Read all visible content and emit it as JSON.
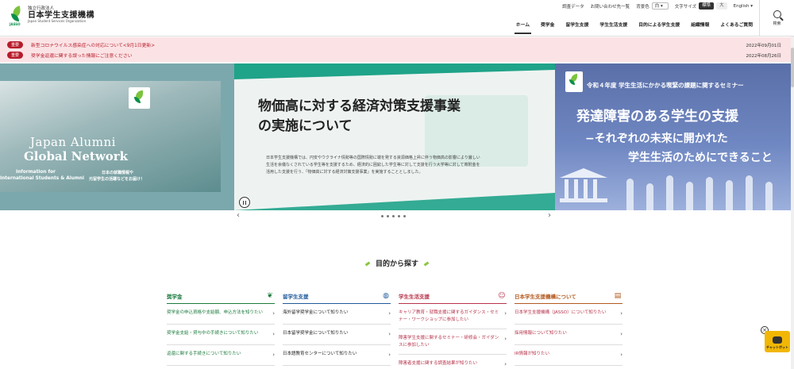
{
  "header": {
    "org_small": "独立行政法人",
    "org_name": "日本学生支援機構",
    "org_en": "Japan Student Services Organization",
    "logo_abbr": "JASSO",
    "util": {
      "survey": "調査データ",
      "contact": "お問い合わせ先一覧",
      "bg_label": "背景色",
      "bg_value": "白",
      "fontsize_label": "文字サイズ",
      "size_standard": "標準",
      "size_large": "大",
      "language": "English"
    },
    "nav": [
      "ホーム",
      "奨学金",
      "留学生支援",
      "学生生活支援",
      "目的による学生支援",
      "組織情報",
      "よくあるご質問"
    ],
    "search_label": "検索"
  },
  "notices": [
    {
      "tag": "重要",
      "text": "新型コロナウイルス感染症への対応について<9月1日更新>",
      "date": "2022年09月01日"
    },
    {
      "tag": "重要",
      "text": "奨学金返還に関する誤った情報にご注意ください",
      "date": "2022年08月26日"
    }
  ],
  "hero": {
    "left": {
      "title1": "Japan Alumni",
      "title2": "Global Network",
      "sub1": "Information for",
      "sub2": "International Students & Alumni",
      "jp1": "日本の就職情報や",
      "jp2": "元留学生の活躍などをお届け！"
    },
    "center": {
      "title_line1": "物価高に対する経済対策支援事業",
      "title_line2": "の実施について",
      "body": "日本学生支援機構では、円安やウクライナ情勢等の国際情勢に端を発する資源価格上昇に伴う物価高の影響により厳しい生活を余儀なくされている学生等を支援するため、経済的に困窮した学生等に対して支援を行う大学等に対して寄附金を活用した支援を行う、「物価高に対する経済対策支援事業」を実施することとしました。"
    },
    "right": {
      "logo_abbr": "JASSO",
      "line1": "令和４年度 学生生活にかかる喫緊の課題に関するセミナー",
      "line2": "発達障害のある学生の支援",
      "line3": "−それぞれの未来に開かれた",
      "line4": "学生生活のためにできること"
    },
    "prev_arrow": "‹",
    "next_arrow": "›"
  },
  "purpose": {
    "title": "目的から探す",
    "columns": [
      {
        "title": "奨学金",
        "icon": "leaf-icon",
        "items": [
          "奨学金の申込資格や支給額、申込方法を知りたい",
          "奨学金支給・貸与中の手続きについて知りたい",
          "返還に関する手続きについて知りたい"
        ]
      },
      {
        "title": "留学生支援",
        "icon": "globe-icon",
        "items": [
          "海外留学奨学金について知りたい",
          "日本留学奨学金について知りたい",
          "日本語教育センターについて知りたい"
        ]
      },
      {
        "title": "学生生活支援",
        "icon": "people-icon",
        "items": [
          "キャリア教育・就職支援に関するガイダンス・セミナー・ワークショップに参加したい",
          "障害学生支援に関するセミナー・研修会・ガイダンスに参加したい",
          "障害者支援に関する調査結果が知りたい"
        ]
      },
      {
        "title": "日本学生支援機構について",
        "icon": "building-icon",
        "items": [
          "日本学生支援機構（JASSO）について知りたい",
          "採用情報について知りたい",
          "IR情報が知りたい"
        ]
      }
    ]
  },
  "chatbot": {
    "label": "チャットボット",
    "close": "×"
  },
  "colors": {
    "accent_green": "#1fa389",
    "notice_red": "#b71c2b",
    "notice_bg": "#fbe3e5"
  }
}
